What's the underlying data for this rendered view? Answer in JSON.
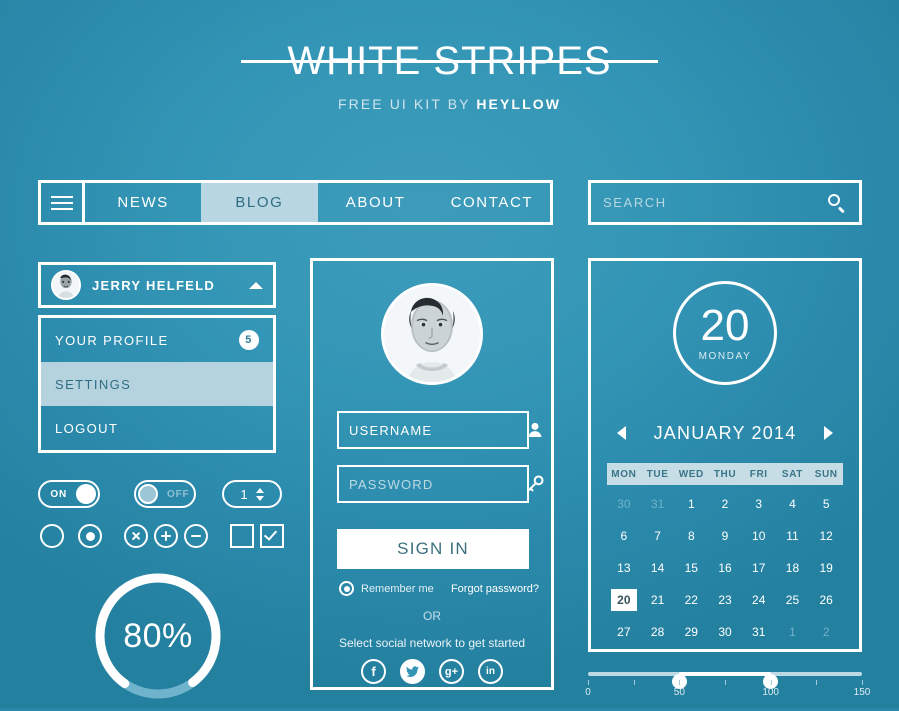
{
  "brand": {
    "logo": "WHITE STRIPES",
    "tagline_prefix": "FREE UI KIT BY ",
    "tagline_brand": "HEYLLOW",
    "accent_white": "#ffffff",
    "bg_teal": "#2a88ab",
    "active_light": "#b9d7e2"
  },
  "nav": {
    "burger_icon": "hamburger-icon",
    "items": [
      {
        "label": "NEWS",
        "active": false
      },
      {
        "label": "BLOG",
        "active": true
      },
      {
        "label": "ABOUT",
        "active": false
      },
      {
        "label": "CONTACT",
        "active": false
      }
    ]
  },
  "search": {
    "placeholder": "SEARCH",
    "value": "",
    "icon": "search-icon"
  },
  "profile": {
    "name": "JERRY HELFELD",
    "caret_icon": "chevron-up-icon",
    "avatar_icon": "avatar",
    "menu": [
      {
        "label": "YOUR PROFILE",
        "badge": "5",
        "active": false
      },
      {
        "label": "SETTINGS",
        "badge": "",
        "active": true
      },
      {
        "label": "LOGOUT",
        "badge": "",
        "active": false
      }
    ]
  },
  "controls": {
    "toggle_on_label": "ON",
    "toggle_off_label": "OFF",
    "stepper_value": "1",
    "icons": [
      "radio-unchecked-icon",
      "radio-checked-icon",
      "circle-close-icon",
      "circle-plus-icon",
      "circle-minus-icon",
      "checkbox-unchecked-icon",
      "checkbox-checked-icon"
    ]
  },
  "progress": {
    "label": "80%",
    "percent": 80
  },
  "login": {
    "avatar_icon": "user-photo",
    "username_value": "USERNAME",
    "username_placeholder": "USERNAME",
    "username_icon": "person-icon",
    "password_value": "",
    "password_placeholder": "PASSWORD",
    "password_icon": "key-icon",
    "signin_label": "SIGN IN",
    "remember_label": "Remember me",
    "forgot_label": "Forgot password?",
    "or_label": "OR",
    "social_label": "Select social network to get started",
    "socials": [
      {
        "name": "facebook-icon",
        "glyph": "f",
        "filled": false
      },
      {
        "name": "twitter-icon",
        "glyph": "t",
        "filled": true
      },
      {
        "name": "google-plus-icon",
        "glyph": "g+",
        "filled": false
      },
      {
        "name": "linkedin-icon",
        "glyph": "in",
        "filled": false
      }
    ]
  },
  "calendar": {
    "selected_day": "20",
    "selected_weekday": "MONDAY",
    "month_label": "JANUARY 2014",
    "prev_icon": "chevron-left-icon",
    "next_icon": "chevron-right-icon",
    "weekdays": [
      "MON",
      "TUE",
      "WED",
      "THU",
      "FRI",
      "SAT",
      "SUN"
    ],
    "weeks": [
      [
        {
          "d": "30",
          "mute": true
        },
        {
          "d": "31",
          "mute": true
        },
        {
          "d": "1"
        },
        {
          "d": "2"
        },
        {
          "d": "3"
        },
        {
          "d": "4"
        },
        {
          "d": "5"
        }
      ],
      [
        {
          "d": "6"
        },
        {
          "d": "7"
        },
        {
          "d": "8"
        },
        {
          "d": "9"
        },
        {
          "d": "10"
        },
        {
          "d": "11"
        },
        {
          "d": "12"
        }
      ],
      [
        {
          "d": "13"
        },
        {
          "d": "14"
        },
        {
          "d": "15"
        },
        {
          "d": "16"
        },
        {
          "d": "17"
        },
        {
          "d": "18"
        },
        {
          "d": "19"
        }
      ],
      [
        {
          "d": "20",
          "sel": true
        },
        {
          "d": "21"
        },
        {
          "d": "22"
        },
        {
          "d": "23"
        },
        {
          "d": "24"
        },
        {
          "d": "25"
        },
        {
          "d": "26"
        }
      ],
      [
        {
          "d": "27"
        },
        {
          "d": "28"
        },
        {
          "d": "29"
        },
        {
          "d": "30"
        },
        {
          "d": "31"
        },
        {
          "d": "1",
          "mute": true
        },
        {
          "d": "2",
          "mute": true
        }
      ]
    ]
  },
  "slider": {
    "min": 0,
    "max": 150,
    "handles": [
      50,
      100
    ],
    "tick_labels": [
      "0",
      "50",
      "100",
      "150"
    ]
  }
}
